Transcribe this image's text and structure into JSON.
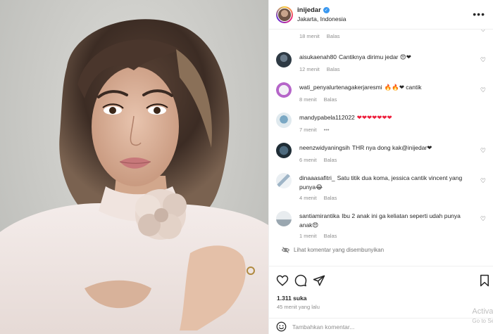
{
  "post": {
    "username": "inijedar",
    "location": "Jakarta, Indonesia",
    "likes": "1.311 suka",
    "time_ago": "45 menit yang lalu"
  },
  "comments": [
    {
      "username": "",
      "text": "",
      "time": "18 menit",
      "reply": "Balas",
      "truncated": true
    },
    {
      "username": "aisukaenah80",
      "text": "Cantiknya dirimu jedar 😍❤",
      "time": "12 menit",
      "reply": "Balas"
    },
    {
      "username": "wati_penyalurtenagakerjaresmi",
      "text": "🔥🔥❤ cantik",
      "time": "8 menit",
      "reply": "Balas"
    },
    {
      "username": "mandypabela112022",
      "text": "❤❤❤❤❤❤❤",
      "time": "7 menit",
      "reply": "•••"
    },
    {
      "username": "neenzwidyaningsih",
      "text": "THR nya dong kak@inijedar❤",
      "time": "6 menit",
      "reply": "Balas"
    },
    {
      "username": "dinaaasafitri_",
      "text": "Satu titik dua koma, jessica cantik vincent yang punya😂",
      "time": "4 menit",
      "reply": "Balas"
    },
    {
      "username": "santiamirantika",
      "text": "Ibu 2 anak ini ga keliatan seperti udah punya anak😍",
      "time": "1 menit",
      "reply": "Balas"
    }
  ],
  "hidden_comments_label": "Lihat komentar yang disembunyikan",
  "add_comment": {
    "placeholder": "Tambahkan komentar..."
  },
  "watermark": {
    "line1": "Activa",
    "line2": "Go to Se"
  },
  "colors": {
    "accent_red": "#ed1c3a",
    "verified_blue": "#3897f0",
    "muted_text": "#8e8e8e"
  }
}
